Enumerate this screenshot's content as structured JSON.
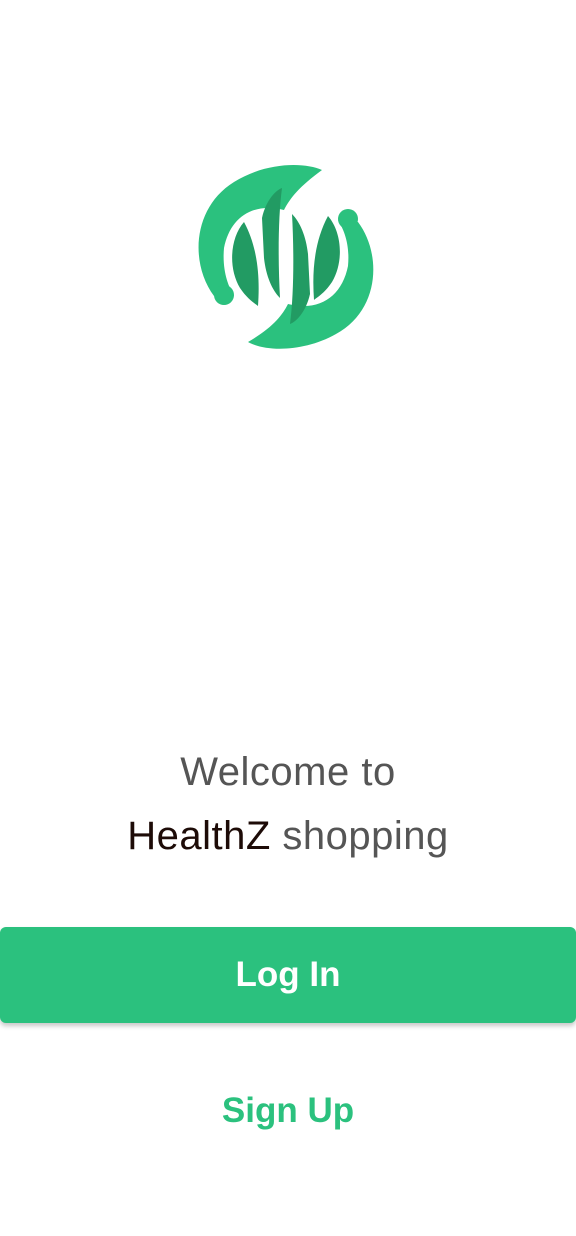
{
  "logo": {
    "icon": "healthz-logo-icon",
    "colors": {
      "outer": "#2bc17e",
      "inner": "#229b63"
    }
  },
  "welcome": {
    "line1": "Welcome to",
    "brand": "HealthZ",
    "suffix": "shopping"
  },
  "actions": {
    "login_label": "Log In",
    "signup_label": "Sign Up"
  },
  "colors": {
    "accent": "#2bc17e",
    "text": "#555555",
    "brand_text": "#1d0b07"
  }
}
